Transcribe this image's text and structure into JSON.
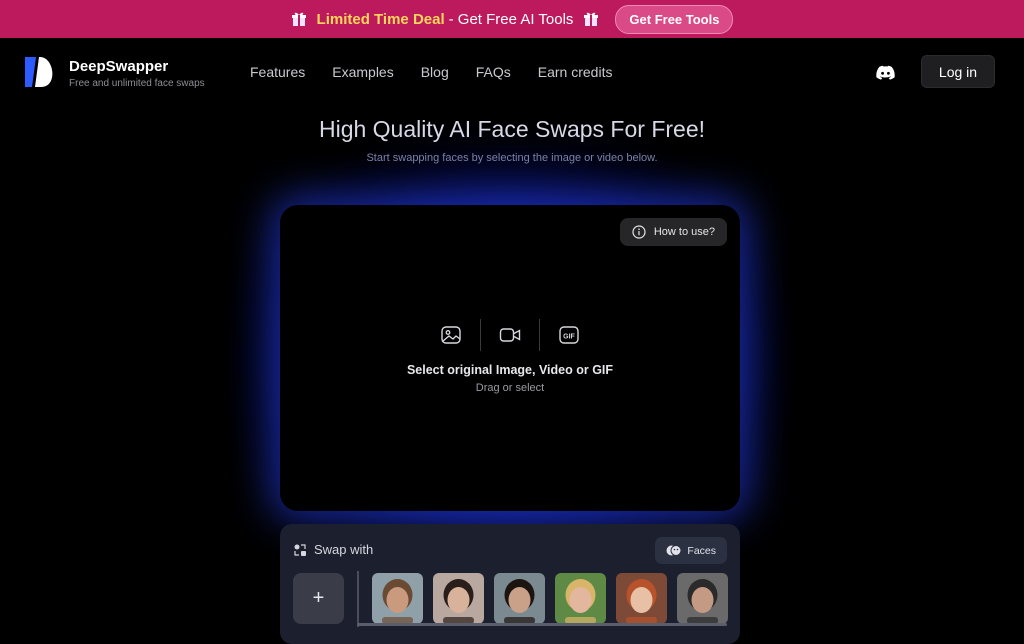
{
  "promo": {
    "deal": "Limited Time Deal",
    "text": "- Get Free AI Tools",
    "cta": "Get Free Tools"
  },
  "nav": {
    "brand": "DeepSwapper",
    "tagline": "Free and unlimited face swaps",
    "items": [
      "Features",
      "Examples",
      "Blog",
      "FAQs",
      "Earn credits"
    ],
    "login": "Log in"
  },
  "hero": {
    "title": "High Quality AI Face Swaps For Free!",
    "subtitle": "Start swapping faces by selecting the image or video below."
  },
  "dropzone": {
    "how_to": "How to use?",
    "title": "Select original Image, Video or GIF",
    "subtitle": "Drag or select",
    "gif_label": "GIF"
  },
  "swap_panel": {
    "title": "Swap with",
    "faces_button": "Faces",
    "add_label": "+",
    "thumbnails": [
      {
        "name": "face-1",
        "skin": "#c99a7e",
        "hair": "#6b4a33",
        "bg": "#8fa0a8"
      },
      {
        "name": "face-2",
        "skin": "#d9b29c",
        "hair": "#2a1e1a",
        "bg": "#b8a8a0"
      },
      {
        "name": "face-3",
        "skin": "#c9a088",
        "hair": "#1c1410",
        "bg": "#7a8a90"
      },
      {
        "name": "face-4",
        "skin": "#e2b79e",
        "hair": "#d9b56a",
        "bg": "#5e8a46"
      },
      {
        "name": "face-5",
        "skin": "#e8c0a6",
        "hair": "#b8522a",
        "bg": "#7d4a38"
      },
      {
        "name": "face-6",
        "skin": "#c49a84",
        "hair": "#2a2a2a",
        "bg": "#6a6a6a"
      }
    ]
  },
  "colors": {
    "promo_bg": "#bd1a5e",
    "deal_text": "#ffd75a",
    "glow": "#2846ff",
    "panel_bg": "#1b1f2e"
  }
}
